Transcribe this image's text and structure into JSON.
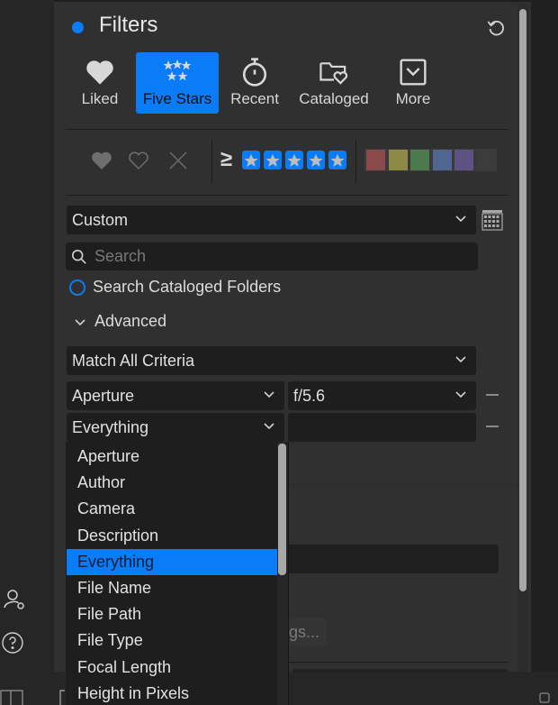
{
  "header": {
    "title": "Filters",
    "status_dot_color": "#0a7cf7",
    "reset_icon": "reset-icon"
  },
  "quick_filters": [
    {
      "label": "Liked",
      "icon": "heart-icon",
      "active": false
    },
    {
      "label": "Five Stars",
      "icon": "five-stars-icon",
      "active": true
    },
    {
      "label": "Recent",
      "icon": "stopwatch-icon",
      "active": false
    },
    {
      "label": "Cataloged",
      "icon": "folder-heart-icon",
      "active": false
    },
    {
      "label": "More",
      "icon": "chevron-box-icon",
      "active": false
    }
  ],
  "flag_filters": [
    {
      "name": "liked",
      "icon": "heart-filled-icon"
    },
    {
      "name": "unflagged",
      "icon": "heart-outline-icon"
    },
    {
      "name": "rejected",
      "icon": "x-icon"
    }
  ],
  "rating_filter": {
    "operator": "≥",
    "stars": 5
  },
  "color_labels": [
    {
      "name": "red",
      "color": "#8a4a4c"
    },
    {
      "name": "yellow",
      "color": "#8e8a45"
    },
    {
      "name": "green",
      "color": "#4d7a4d"
    },
    {
      "name": "blue",
      "color": "#4f6690"
    },
    {
      "name": "purple",
      "color": "#5d5282"
    },
    {
      "name": "none",
      "color": "#3c3c3c"
    }
  ],
  "preset": {
    "value": "Custom"
  },
  "search": {
    "placeholder": "Search",
    "value": ""
  },
  "search_cataloged": {
    "label": "Search Cataloged Folders",
    "checked": false
  },
  "advanced": {
    "label": "Advanced",
    "expanded": true,
    "match": "Match All Criteria",
    "criteria": [
      {
        "field": "Aperture",
        "value": "f/5.6"
      },
      {
        "field": "Everything",
        "value": ""
      }
    ]
  },
  "dropdown": {
    "options": [
      "Aperture",
      "Author",
      "Camera",
      "Description",
      "Everything",
      "File Name",
      "File Path",
      "File Type",
      "Focal Length",
      "Height in Pixels"
    ],
    "selected": "Everything"
  },
  "partial_button": {
    "label": "gs..."
  },
  "rail": {
    "account_icon": "account-settings-icon",
    "help_icon": "help-icon"
  }
}
